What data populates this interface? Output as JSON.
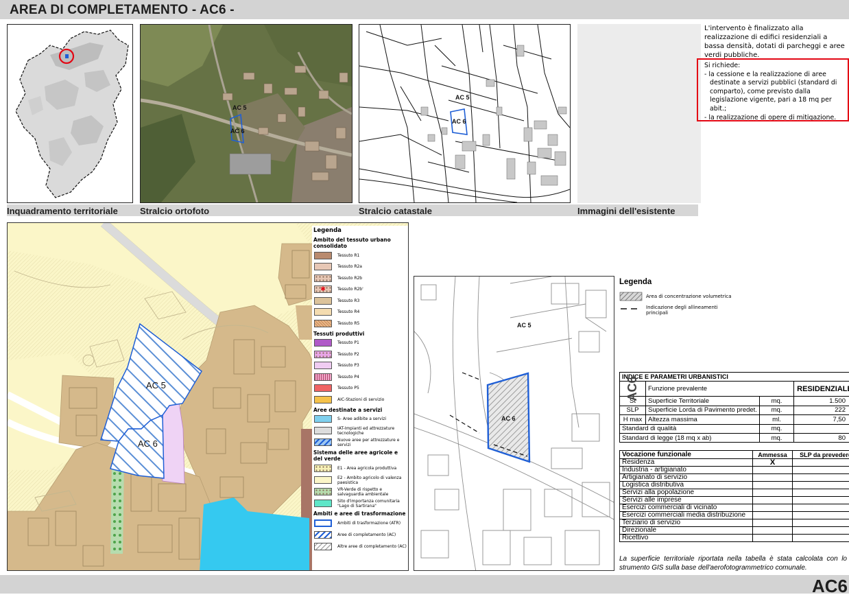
{
  "header": {
    "title": "AREA DI COMPLETAMENTO - AC6 -"
  },
  "footer": {
    "code": "AC6"
  },
  "captions": {
    "inquadramento": "Inquadramento territoriale",
    "ortofoto": "Stralcio ortofoto",
    "catastale": "Stralcio catastale",
    "esistente": "Immagini dell'esistente"
  },
  "description": {
    "intro": "L'intervento è finalizzato alla realizzazione di edifici residenziali a bassa densità, dotati di parcheggi e aree verdi pubbliche.",
    "requests_title": "Si richiede:",
    "requests": [
      "- la cessione e la realizzazione di aree destinate a servizi pubblici (standard di comparto), come previsto dalla legislazione vigente, pari a 18 mq per abit.;",
      "- la realizzazione di opere di mitigazione."
    ]
  },
  "map_labels": {
    "ac5": "AC 5",
    "ac6": "AC 6"
  },
  "colors": {
    "red_circle": "#e30613",
    "area_blue": "#1f5fd6",
    "hatch_blue": "#5b8fd6",
    "brown": "#d5b98b",
    "yellow": "#faf3c4",
    "pink": "#efd3f5"
  },
  "plan_legend": {
    "title": "Legenda",
    "sections": [
      {
        "title": "Ambito del tessuto urbano consolidato",
        "items": [
          {
            "label": "Tessuto R1",
            "color": "#b98a6e",
            "pattern": "none"
          },
          {
            "label": "Tessuto R2a",
            "color": "#e7c7b5",
            "pattern": "none"
          },
          {
            "label": "Tessuto R2b",
            "color": "#e7c7b5",
            "pattern": "dots"
          },
          {
            "label": "Tessuto R2b'",
            "color": "#e7c7b5",
            "pattern": "star"
          },
          {
            "label": "Tessuto R3",
            "color": "#dcc39a",
            "pattern": "none"
          },
          {
            "label": "Tessuto R4",
            "color": "#f4dcb0",
            "pattern": "none"
          },
          {
            "label": "Tessuto R5",
            "color": "#e8b78a",
            "pattern": "hatch"
          }
        ]
      },
      {
        "title": "Tessuti produttivi",
        "items": [
          {
            "label": "Tessuto P1",
            "color": "#b05ac8",
            "pattern": "none"
          },
          {
            "label": "Tessuto P2",
            "color": "#e9a6e9",
            "pattern": "dots"
          },
          {
            "label": "Tessuto P3",
            "color": "#f0ccf2",
            "pattern": "none"
          },
          {
            "label": "Tessuto P4",
            "color": "#f0a6c8",
            "pattern": "vlines"
          },
          {
            "label": "Tessuto P5",
            "color": "#f06464",
            "pattern": "none"
          },
          {
            "label": "AIC-Stazioni di servizio",
            "color": "#f5c24a",
            "pattern": "none"
          }
        ]
      },
      {
        "title": "Aree destinate a servizi",
        "items": [
          {
            "label": "S- Aree adibite a servizi",
            "color": "#7fd0ee",
            "pattern": "none"
          },
          {
            "label": "IAT-Impianti ed attrezzature tecnologiche",
            "color": "#dddddd",
            "pattern": "none"
          },
          {
            "label": "Nuove aree per attrezzature e servizi",
            "color": "#9ec7f0",
            "pattern": "bluehatch"
          }
        ]
      },
      {
        "title": "Sistema delle aree agricole e del verde",
        "items": [
          {
            "label": "E1 - Area agricola produttiva",
            "color": "#f7f2b8",
            "pattern": "dots"
          },
          {
            "label": "E2 - Ambito agricolo di valenza paesistica",
            "color": "#fbf6c8",
            "pattern": "none"
          },
          {
            "label": "VR-Verde di rispetto e salvaguardia ambientale",
            "color": "#b6dcae",
            "pattern": "dots"
          },
          {
            "label": "Sito d'importanza comunitaria \"Lago di Sartirana\"",
            "color": "#5fe6c8",
            "pattern": "none"
          }
        ]
      },
      {
        "title": "Ambiti e aree di trasformazione",
        "items": [
          {
            "label": "Ambiti di trasformazione (ATR)",
            "color": "#ffffff",
            "pattern": "blueborder"
          },
          {
            "label": "Aree di completamento (AC)",
            "color": "#ffffff",
            "pattern": "bluehatch"
          },
          {
            "label": "Altre aree di completamento (AC)",
            "color": "#ffffff",
            "pattern": "greyhatch"
          }
        ]
      }
    ]
  },
  "detail_legend": {
    "title": "Legenda",
    "items": [
      {
        "label": "Area di concentrazione volumetrica",
        "pattern": "hatch"
      },
      {
        "label": "Indicazione degli allineamenti principali",
        "pattern": "dash"
      }
    ]
  },
  "params": {
    "title": "INDICE E PARAMETRI URBANISTICI",
    "side_label": "AC6",
    "function_label": "Funzione prevalente",
    "function_value": "RESIDENZIALE",
    "rows": [
      {
        "code": "St",
        "label": "Superficie Territoriale",
        "unit": "mq.",
        "value": "1.500"
      },
      {
        "code": "SLP",
        "label": "Superficie Lorda di Pavimento predet.",
        "unit": "mq.",
        "value": "222"
      },
      {
        "code": "H max",
        "label": "Altezza massima",
        "unit": "ml.",
        "value": "7,50"
      },
      {
        "code": "",
        "label": "Standard di qualità",
        "unit": "mq.",
        "value": ""
      },
      {
        "code": "",
        "label": "Standard di legge (18 mq x ab)",
        "unit": "mq.",
        "value": "80"
      }
    ]
  },
  "vocazione": {
    "headers": [
      "Vocazione funzionale",
      "Ammessa",
      "SLP da prevedere"
    ],
    "rows": [
      {
        "label": "Residenza",
        "ammessa": "X",
        "slp": ""
      },
      {
        "label": "Industria - artigianato",
        "ammessa": "",
        "slp": ""
      },
      {
        "label": "Artigianato di servizio",
        "ammessa": "",
        "slp": ""
      },
      {
        "label": "Logistica distributiva",
        "ammessa": "",
        "slp": ""
      },
      {
        "label": "Servizi alla popolazione",
        "ammessa": "",
        "slp": ""
      },
      {
        "label": "Servizi alle imprese",
        "ammessa": "",
        "slp": ""
      },
      {
        "label": "Esercizi commerciali di vicinato",
        "ammessa": "",
        "slp": ""
      },
      {
        "label": "Esercizi commerciali media distribuzione",
        "ammessa": "",
        "slp": ""
      },
      {
        "label": "Terziario di servizio",
        "ammessa": "",
        "slp": ""
      },
      {
        "label": "Direzionale",
        "ammessa": "",
        "slp": ""
      },
      {
        "label": "Ricettivo",
        "ammessa": "",
        "slp": ""
      }
    ]
  },
  "note": "La superficie territoriale riportata nella tabella è stata calcolata con lo strumento GIS sulla base dell'aerofotogrammetrico comunale."
}
